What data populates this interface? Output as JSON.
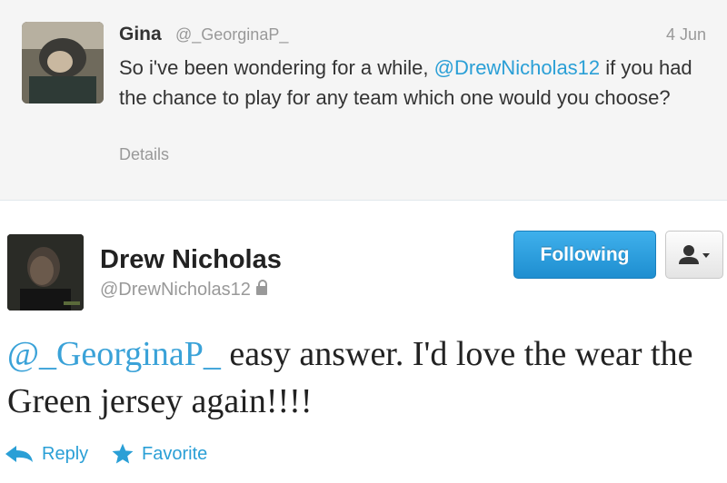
{
  "reply": {
    "name": "Gina",
    "handle": "@_GeorginaP_",
    "time": "4 Jun",
    "text_before": "So i've been wondering for a while, ",
    "mention": "@DrewNicholas12",
    "text_after": " if you had the chance to play for any team which one would you choose?",
    "details_label": "Details"
  },
  "tweet": {
    "name": "Drew Nicholas",
    "handle": "@DrewNicholas12",
    "follow_label": "Following",
    "mention": "@_GeorginaP_",
    "text": " easy answer. I'd love the wear the Green jersey again!!!!"
  },
  "actions": {
    "reply_label": "Reply",
    "favorite_label": "Favorite"
  },
  "colors": {
    "link": "#2a9fd6",
    "follow_button": "#2a9fd6",
    "reply_background": "#f5f5f5"
  },
  "icons": {
    "lock": "lock-icon",
    "user_menu": "user-dropdown-icon",
    "reply": "reply-arrow-icon",
    "favorite": "star-icon"
  }
}
